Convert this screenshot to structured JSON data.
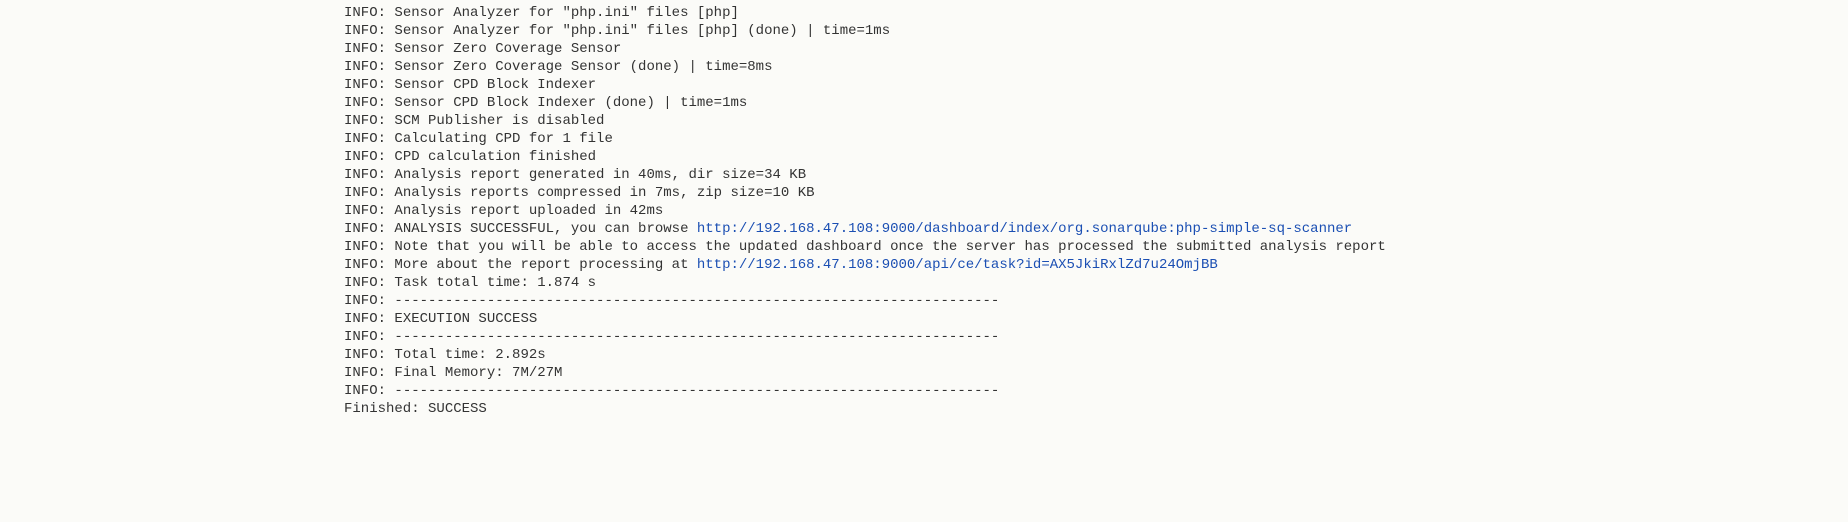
{
  "log": {
    "prefix": "INFO: ",
    "lines": [
      {
        "text": "Sensor Analyzer for \"php.ini\" files [php]"
      },
      {
        "text": "Sensor Analyzer for \"php.ini\" files [php] (done) | time=1ms"
      },
      {
        "text": "Sensor Zero Coverage Sensor"
      },
      {
        "text": "Sensor Zero Coverage Sensor (done) | time=8ms"
      },
      {
        "text": "Sensor CPD Block Indexer"
      },
      {
        "text": "Sensor CPD Block Indexer (done) | time=1ms"
      },
      {
        "text": "SCM Publisher is disabled"
      },
      {
        "text": "Calculating CPD for 1 file"
      },
      {
        "text": "CPD calculation finished"
      },
      {
        "text": "Analysis report generated in 40ms, dir size=34 KB"
      },
      {
        "text": "Analysis reports compressed in 7ms, zip size=10 KB"
      },
      {
        "text": "Analysis report uploaded in 42ms"
      },
      {
        "text": "ANALYSIS SUCCESSFUL, you can browse ",
        "link": "http://192.168.47.108:9000/dashboard/index/org.sonarqube:php-simple-sq-scanner"
      },
      {
        "text": "Note that you will be able to access the updated dashboard once the server has processed the submitted analysis report"
      },
      {
        "text": "More about the report processing at ",
        "link": "http://192.168.47.108:9000/api/ce/task?id=AX5JkiRxlZd7u24OmjBB"
      },
      {
        "text": "Task total time: 1.874 s"
      },
      {
        "text": "------------------------------------------------------------------------"
      },
      {
        "text": "EXECUTION SUCCESS"
      },
      {
        "text": "------------------------------------------------------------------------"
      },
      {
        "text": "Total time: 2.892s"
      },
      {
        "text": "Final Memory: 7M/27M"
      },
      {
        "text": "------------------------------------------------------------------------"
      }
    ],
    "finished": "Finished: SUCCESS"
  }
}
